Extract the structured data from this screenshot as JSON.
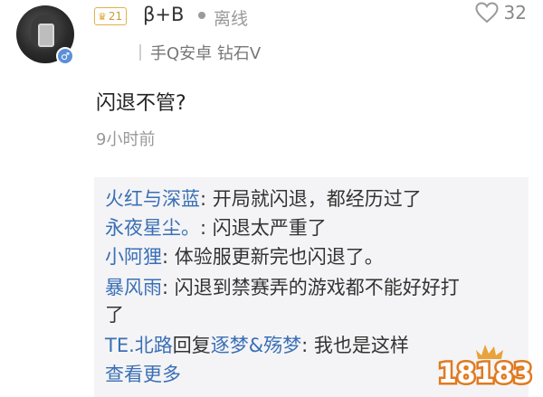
{
  "comment": {
    "author": "β+B",
    "level": "21",
    "online_status": "离线",
    "device": "手Q安卓 钻石V",
    "text": "闪退不管?",
    "time": "9小时前",
    "likes": "32"
  },
  "replies": [
    {
      "user": "火红与深蓝",
      "text": ": 开局就闪退，都经历过了"
    },
    {
      "user": "永夜星尘。",
      "text": ": 闪退太严重了"
    },
    {
      "user": "小阿狸",
      "text": ": 体验服更新完也闪退了。"
    },
    {
      "user": "暴风雨",
      "text": ": 闪退到禁赛弄的游戏都不能好好打"
    },
    {
      "user": "",
      "text": "了"
    },
    {
      "user": "TE.北路",
      "reply_word": "回复",
      "target": "逐梦&殇梦",
      "text": ": 我也是这样"
    }
  ],
  "more_label": "查看更多",
  "watermark_text": "18183",
  "colors": {
    "link": "#3a6fb5",
    "level": "#e3b04b",
    "gender": "#5b8fd8"
  },
  "icons": {
    "like": "heart-outline-icon",
    "gender": "male-icon",
    "level": "crown-icon"
  }
}
